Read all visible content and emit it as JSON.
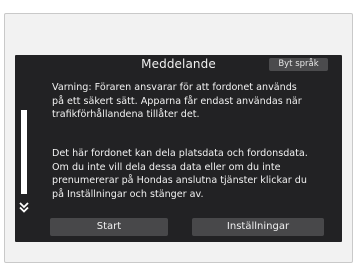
{
  "dialog": {
    "title": "Meddelande",
    "language_button": "Byt språk",
    "warning_text": "Varning: Föraren ansvarar för att fordonet används\npå ett säkert sätt. Apparna får endast användas när\ntrafikförhållandena tillåter det.",
    "data_text": "Det här fordonet kan dela platsdata och fordonsdata.\nOm du inte vill dela dessa data eller om du inte\nprenumererar på Hondas anslutna tjänster klickar du\npå Inställningar och stänger av.",
    "start_button": "Start",
    "settings_button": "Inställningar"
  },
  "icons": {
    "scroll_down": "double-chevron-down-icon"
  },
  "colors": {
    "screen_background": "#222224",
    "button_background": "#48484a",
    "text": "#f2f2f2"
  }
}
